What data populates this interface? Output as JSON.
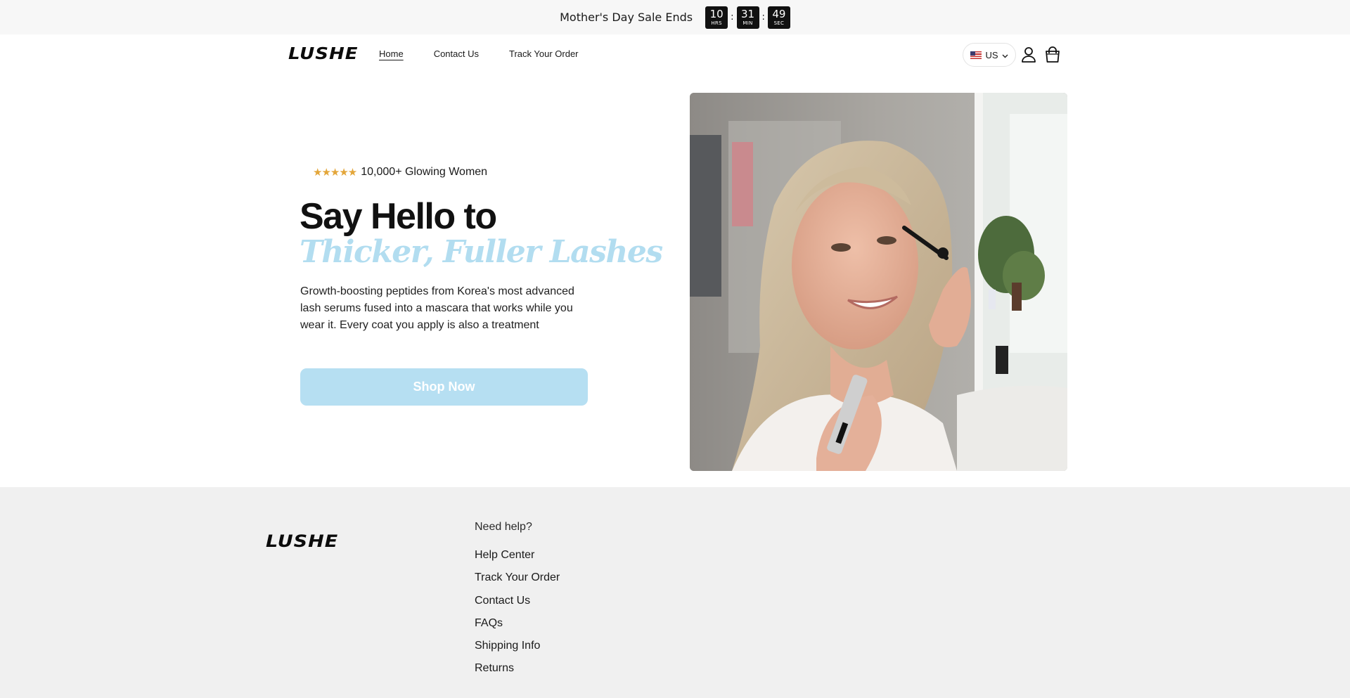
{
  "announcement": {
    "text": "Mother's Day Sale Ends",
    "timer": [
      {
        "value": "10",
        "unit": "HRS"
      },
      {
        "value": "31",
        "unit": "MIN"
      },
      {
        "value": "49",
        "unit": "SEC"
      }
    ],
    "separator": ":"
  },
  "header": {
    "logo": "LUSHE",
    "nav": [
      {
        "label": "Home",
        "active": true
      },
      {
        "label": "Contact Us",
        "active": false
      },
      {
        "label": "Track Your Order",
        "active": false
      }
    ],
    "locale": {
      "code": "US",
      "flag_icon": "us-flag-icon"
    },
    "icons": [
      "account-icon",
      "cart-icon"
    ]
  },
  "hero": {
    "stars": "★★★★★",
    "rating_text": "10,000+ Glowing Women",
    "headline": "Say Hello to",
    "headline_accent": "Thicker, Fuller Lashes",
    "description": "Growth-boosting peptides from Korea's most advanced lash serums fused into a mascara that works while you wear it. Every coat you apply is also a treatment",
    "cta_label": "Shop Now",
    "accent_color": "#b2ddf0",
    "star_color": "#e3a63a"
  },
  "footer": {
    "logo": "LUSHE",
    "heading": "Need help?",
    "links": [
      "Help Center",
      "Track Your Order",
      "Contact Us",
      "FAQs",
      "Shipping Info",
      "Returns"
    ]
  }
}
